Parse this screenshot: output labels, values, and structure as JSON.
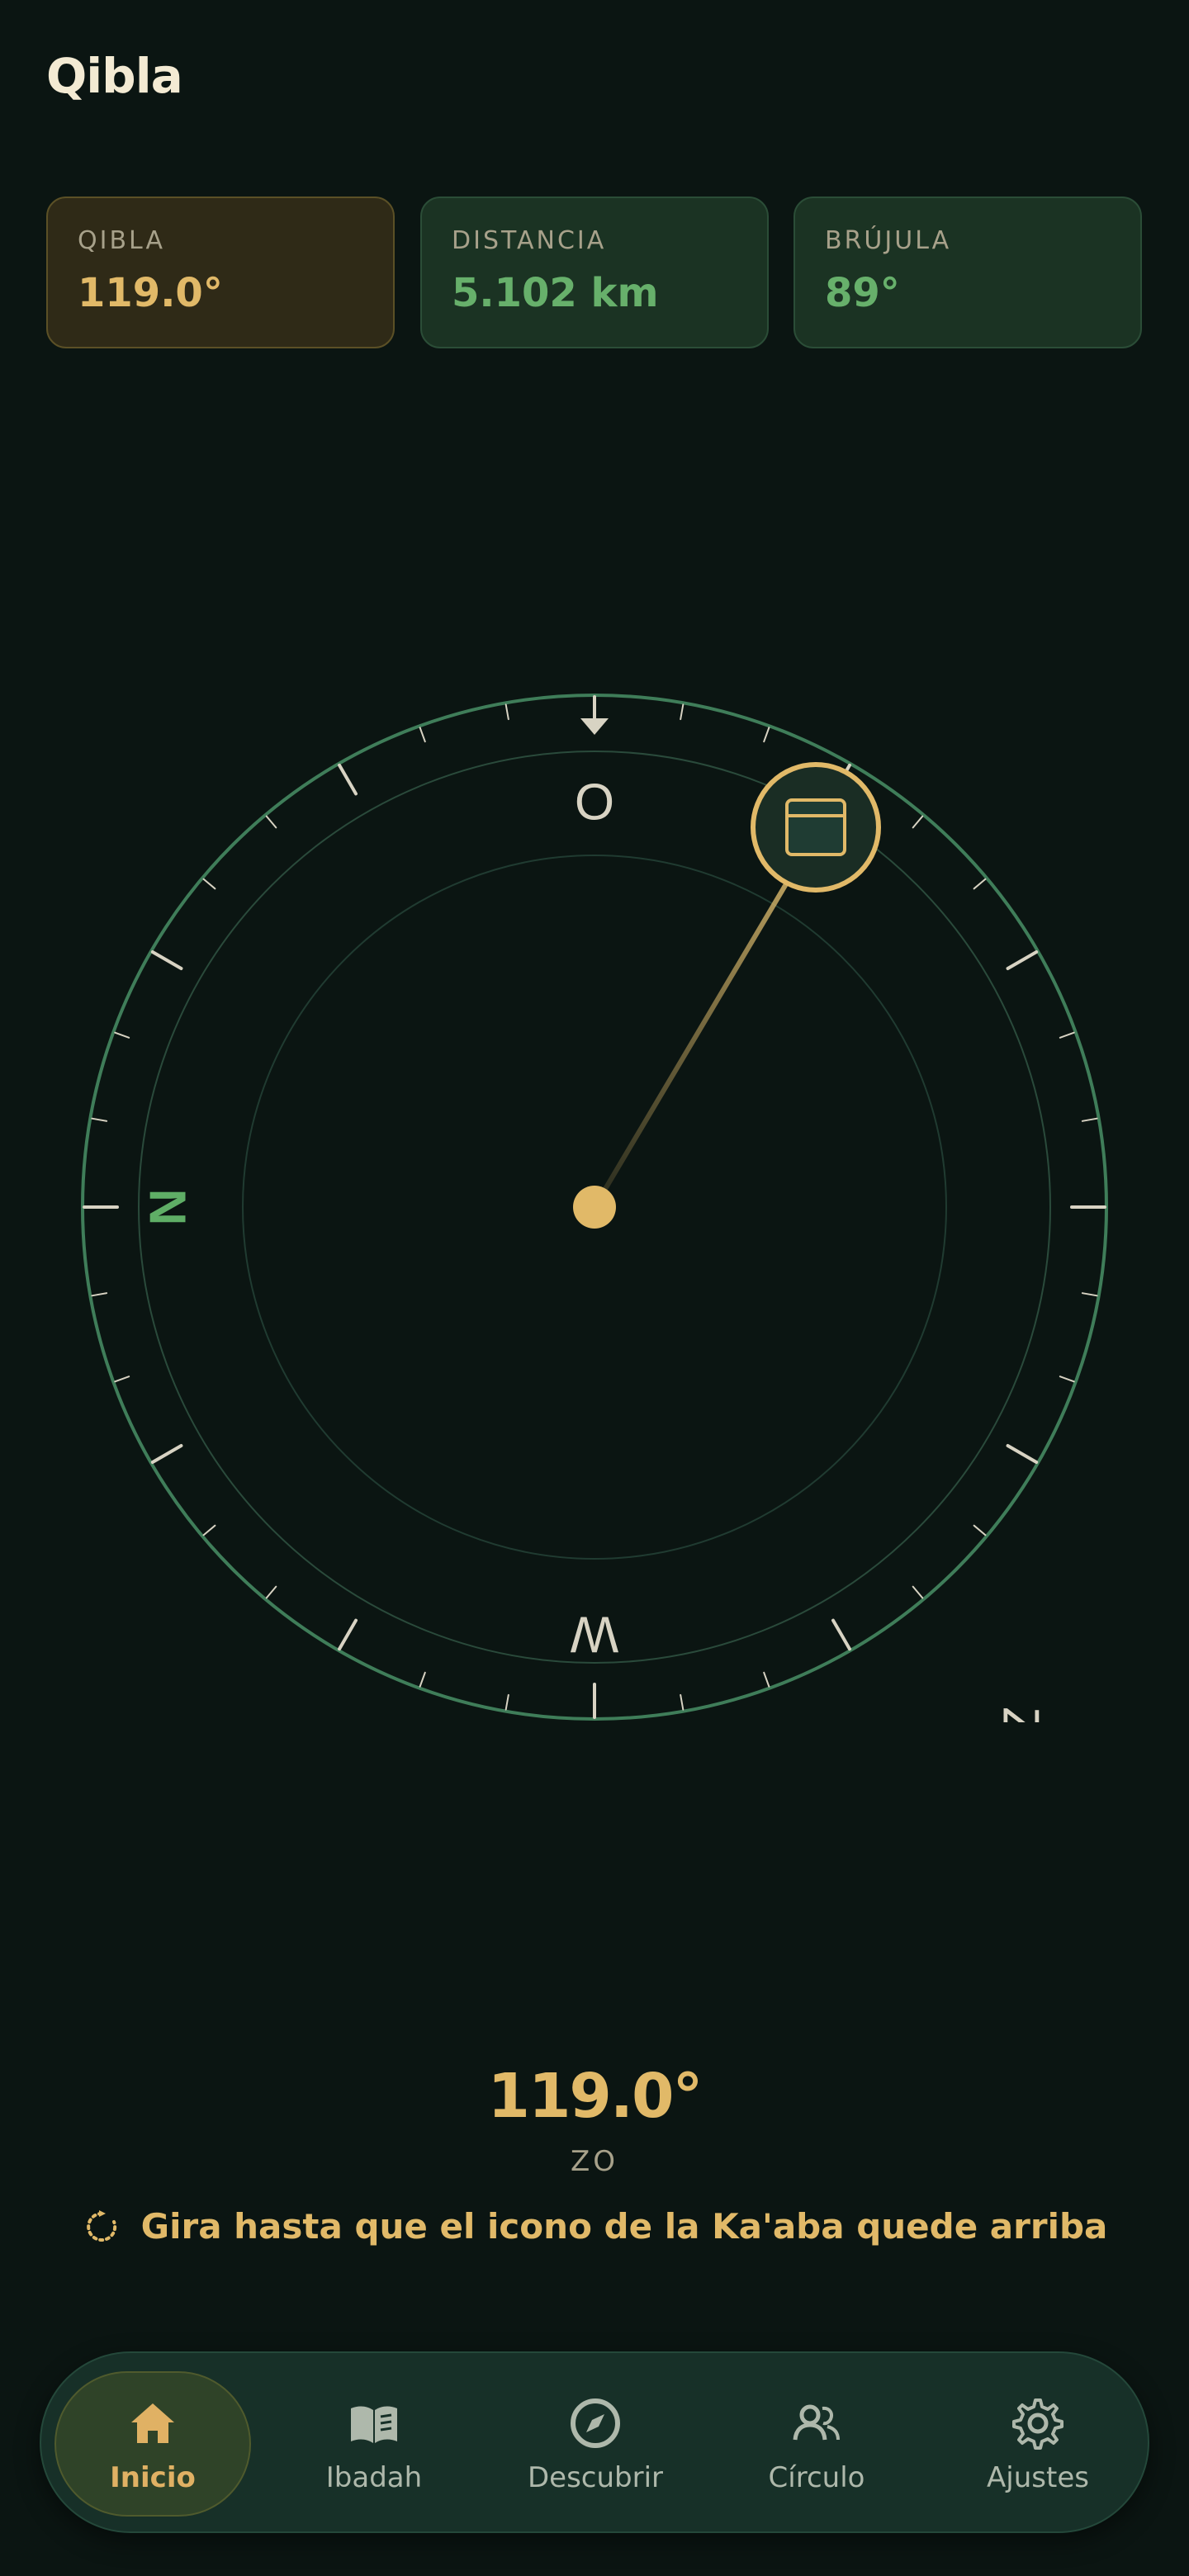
{
  "app": {
    "title": "Qibla"
  },
  "stats": [
    {
      "label": "QIBLA",
      "value": "119.0°"
    },
    {
      "label": "DISTANCIA",
      "value": "5.102 km"
    },
    {
      "label": "BRÚJULA",
      "value": "89°"
    }
  ],
  "compass": {
    "cardinal": {
      "north": "N",
      "east": "Z",
      "south": "W",
      "west": "O"
    },
    "kaaba_icon": "kaaba-icon"
  },
  "heading": {
    "value": "119.0°",
    "direction": "ZO"
  },
  "instruction": {
    "text": "Gira hasta que el icono de la Ka'aba quede arriba",
    "icon": "rotate-icon"
  },
  "nav": [
    {
      "label": "Inicio",
      "icon": "home-icon",
      "active": true
    },
    {
      "label": "Ibadah",
      "icon": "book-icon",
      "active": false
    },
    {
      "label": "Descubrir",
      "icon": "compass-icon",
      "active": false
    },
    {
      "label": "Círculo",
      "icon": "people-icon",
      "active": false
    },
    {
      "label": "Ajustes",
      "icon": "gear-icon",
      "active": false
    }
  ],
  "colors": {
    "background": "#0b1512",
    "accent_gold": "#e1b968",
    "accent_green": "#67b06b",
    "compass_ring": "#3f7d59",
    "nav_bg": "#173028"
  }
}
